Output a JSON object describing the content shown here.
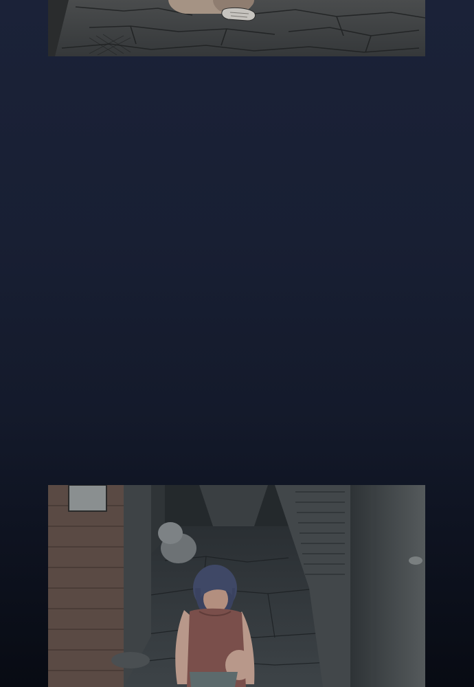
{
  "comic": {
    "background_gradient": [
      "#1b2238",
      "#141a2b",
      "#080b13"
    ],
    "panels": [
      {
        "name": "panel-top",
        "scene": "alley-ground-with-feet"
      },
      {
        "name": "panel-bottom",
        "scene": "alley-girl-kneeling"
      }
    ]
  }
}
